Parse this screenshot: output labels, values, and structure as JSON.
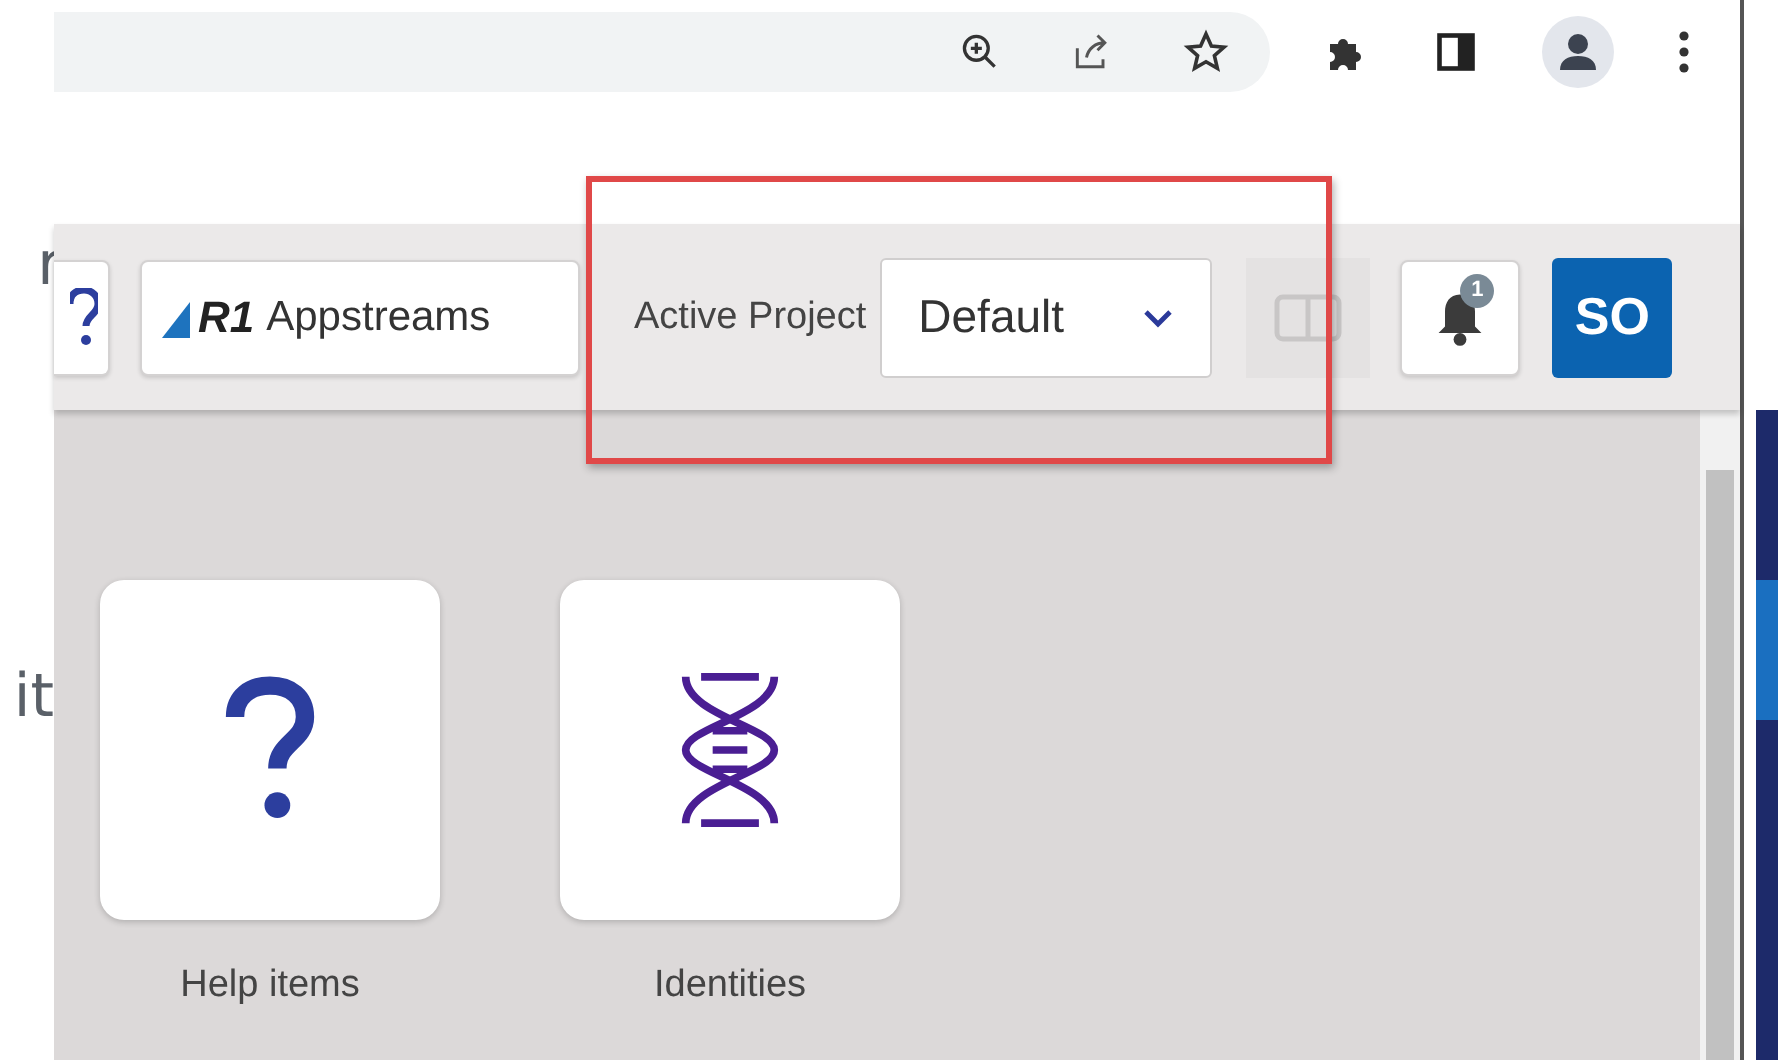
{
  "left_fragments": [
    {
      "text": "r"
    },
    {
      "text": "it"
    }
  ],
  "toolbar": {
    "appstreams_button": {
      "logo_text": "R1",
      "label": "Appstreams"
    },
    "active_project": {
      "label": "Active Project",
      "value": "Default"
    },
    "notifications": {
      "count": "1"
    },
    "user": {
      "initials": "SO"
    }
  },
  "tiles": [
    {
      "kind": "help",
      "label": "Help items"
    },
    {
      "kind": "dna",
      "label": "Identities"
    }
  ]
}
